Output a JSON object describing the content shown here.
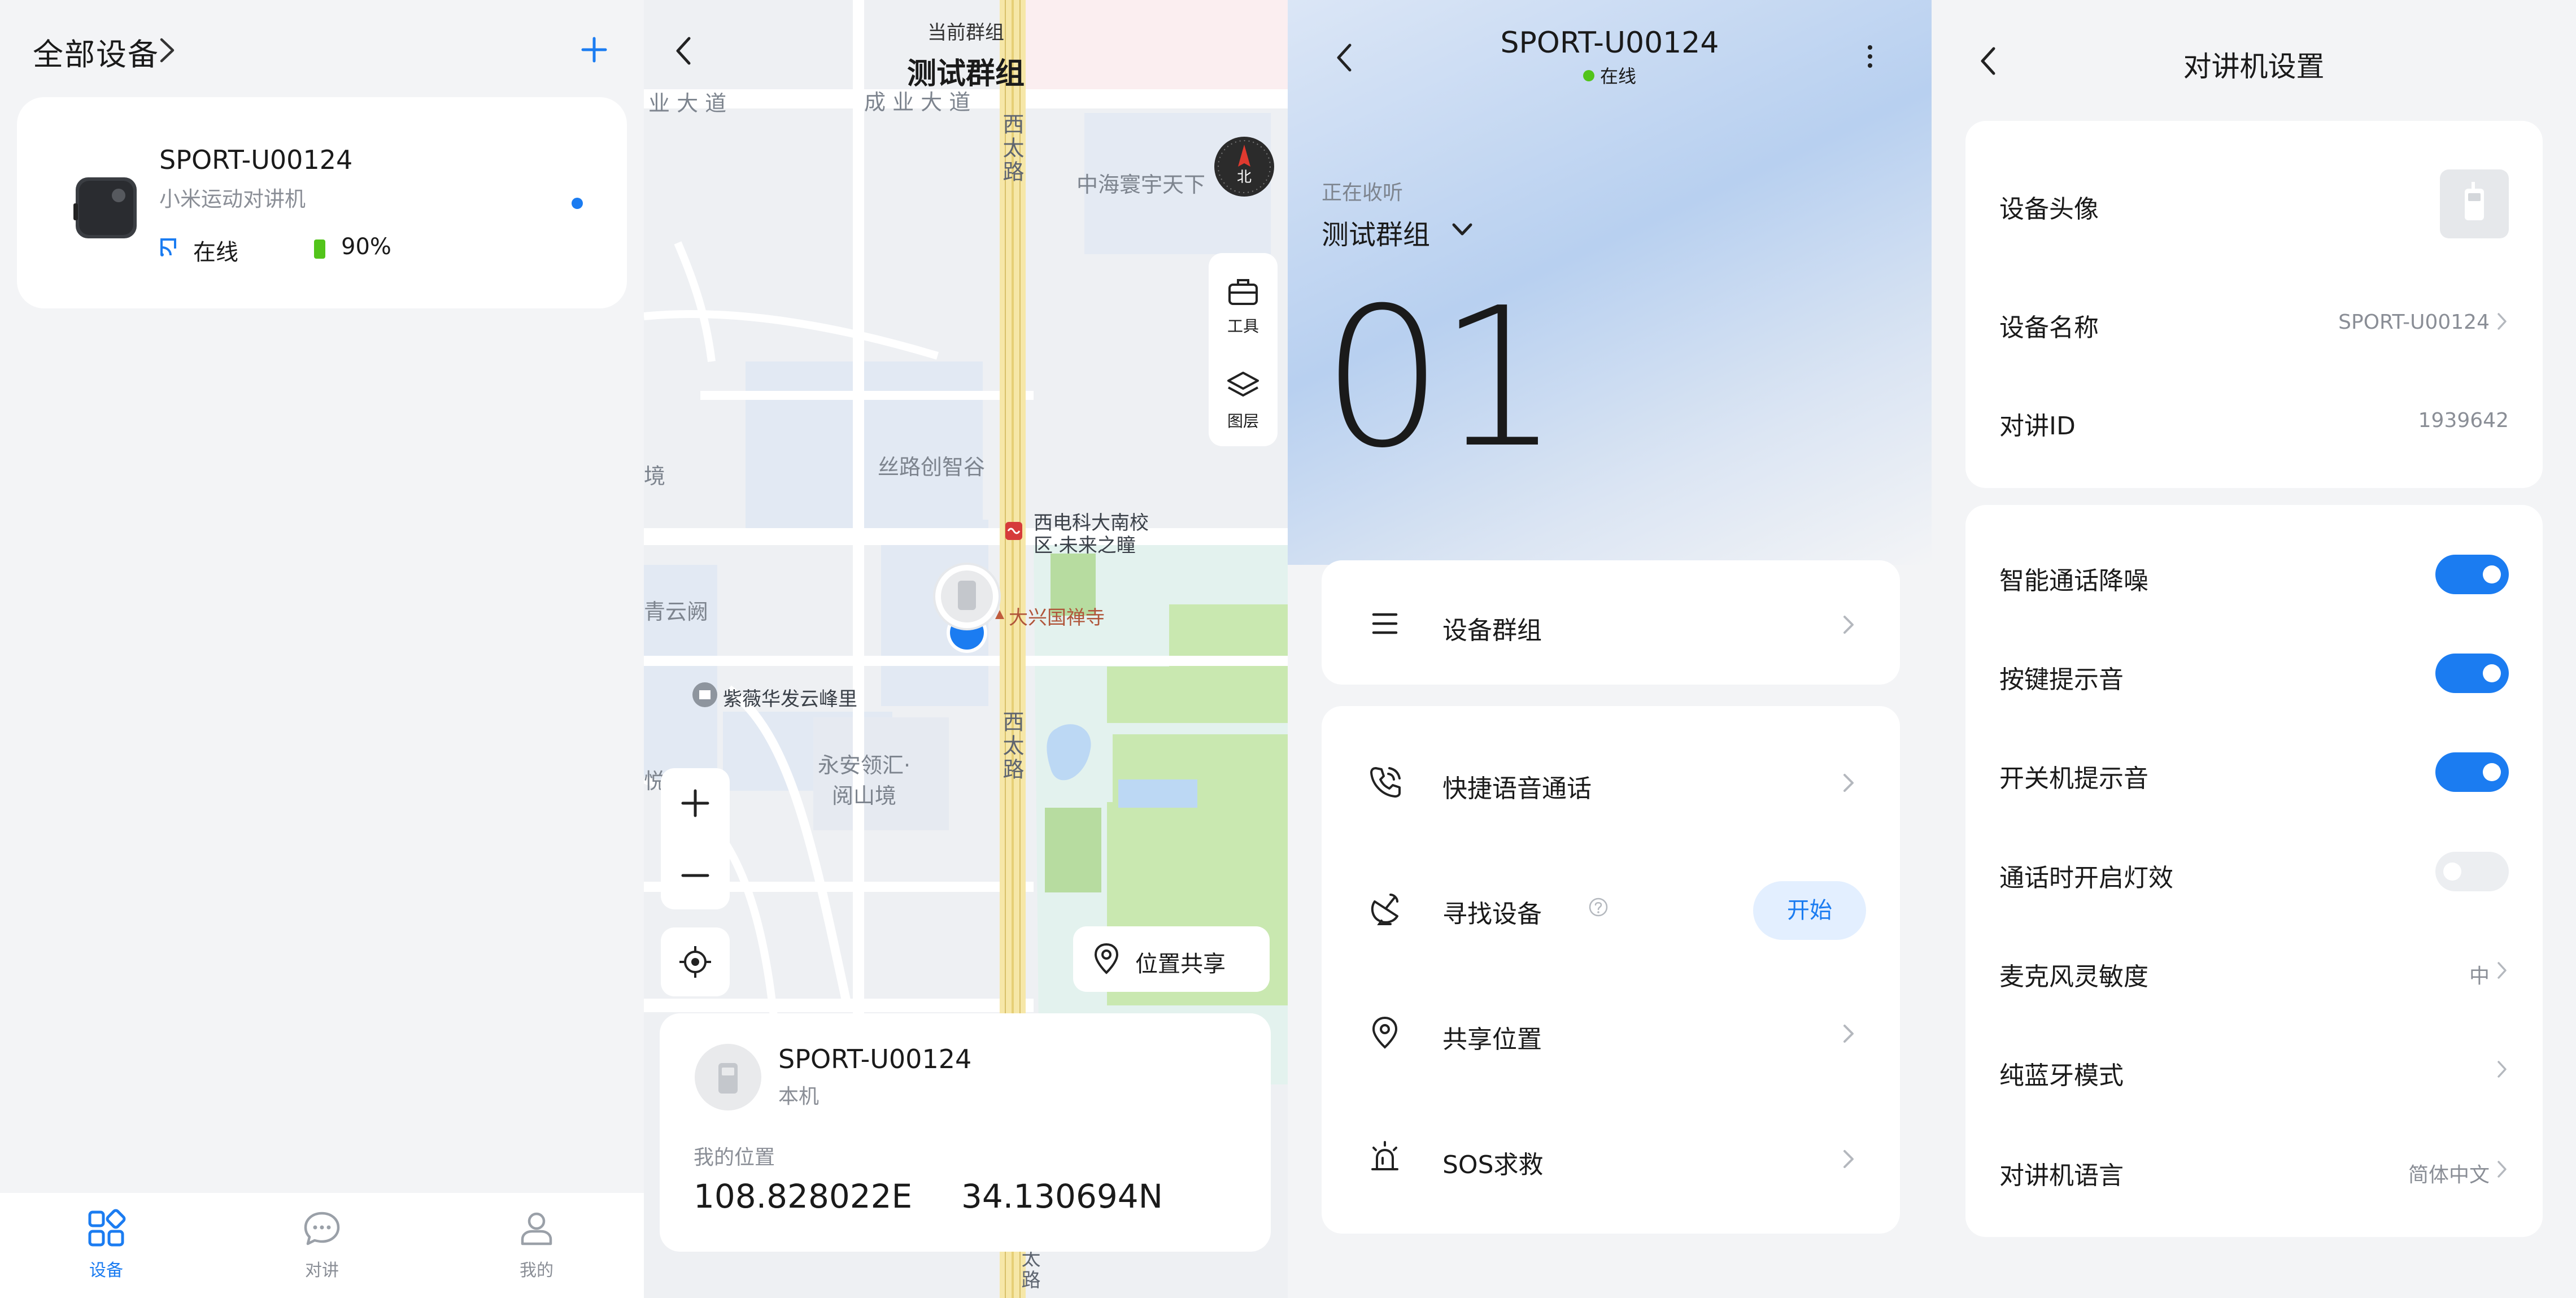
{
  "colors": {
    "accent": "#1b7cf1",
    "online": "#52c41a",
    "background": "#f3f4f6",
    "card": "#ffffff"
  },
  "devices_page": {
    "title": "全部设备",
    "device": {
      "name": "SPORT-U00124",
      "model": "小米运动对讲机",
      "status": "在线",
      "battery": "90%",
      "battery_level": 0.9
    },
    "tabs": [
      {
        "label": "设备",
        "icon": "grid-icon",
        "active": true
      },
      {
        "label": "对讲",
        "icon": "chat-icon",
        "active": false
      },
      {
        "label": "我的",
        "icon": "person-icon",
        "active": false
      }
    ]
  },
  "map_page": {
    "current_group_label": "当前群组",
    "group_name": "测试群组",
    "compass_label": "北",
    "tools": {
      "tools_label": "工具",
      "layers_label": "图层"
    },
    "share_location_label": "位置共享",
    "map_labels": {
      "road_top_left": "业 大 道",
      "road_top_mid": "成 业 大 道",
      "road_xitai_top": "西太路",
      "road_xitai_bottom": "西太路",
      "road_bottom": "太路",
      "poi_zhonghai": "中海寰宇天下",
      "poi_silu": "丝路创智谷",
      "poi_xidian": "西电科大南校区·未来之瞳",
      "poi_daxingguo": "大兴国禅寺",
      "poi_yunque": "青云阙",
      "poi_ziwei": "紫薇华发云峰里",
      "poi_yongan": "永安领汇·阅山境",
      "edge_jing": "境",
      "edge_yue": "悦"
    },
    "device": {
      "name": "SPORT-U00124",
      "sub": "本机"
    },
    "my_location_label": "我的位置",
    "longitude": "108.828022E",
    "latitude": "34.130694N"
  },
  "device_page": {
    "title": "SPORT-U00124",
    "status": "在线",
    "listening_label": "正在收听",
    "group_name": "测试群组",
    "channel": "01",
    "menu": {
      "device_group": "设备群组",
      "quick_voice": "快捷语音通话",
      "find_device": "寻找设备",
      "find_start": "开始",
      "share_location": "共享位置",
      "sos": "SOS求救"
    }
  },
  "settings_page": {
    "title": "对讲机设置",
    "rows": {
      "avatar_label": "设备头像",
      "name_label": "设备名称",
      "name_value": "SPORT-U00124",
      "id_label": "对讲ID",
      "id_value": "1939642",
      "noise_label": "智能通话降噪",
      "noise_on": true,
      "key_tone_label": "按键提示音",
      "key_tone_on": true,
      "power_tone_label": "开关机提示音",
      "power_tone_on": true,
      "light_label": "通话时开启灯效",
      "light_on": false,
      "mic_label": "麦克风灵敏度",
      "mic_value": "中",
      "bt_label": "纯蓝牙模式",
      "lang_label": "对讲机语言",
      "lang_value": "简体中文"
    }
  }
}
